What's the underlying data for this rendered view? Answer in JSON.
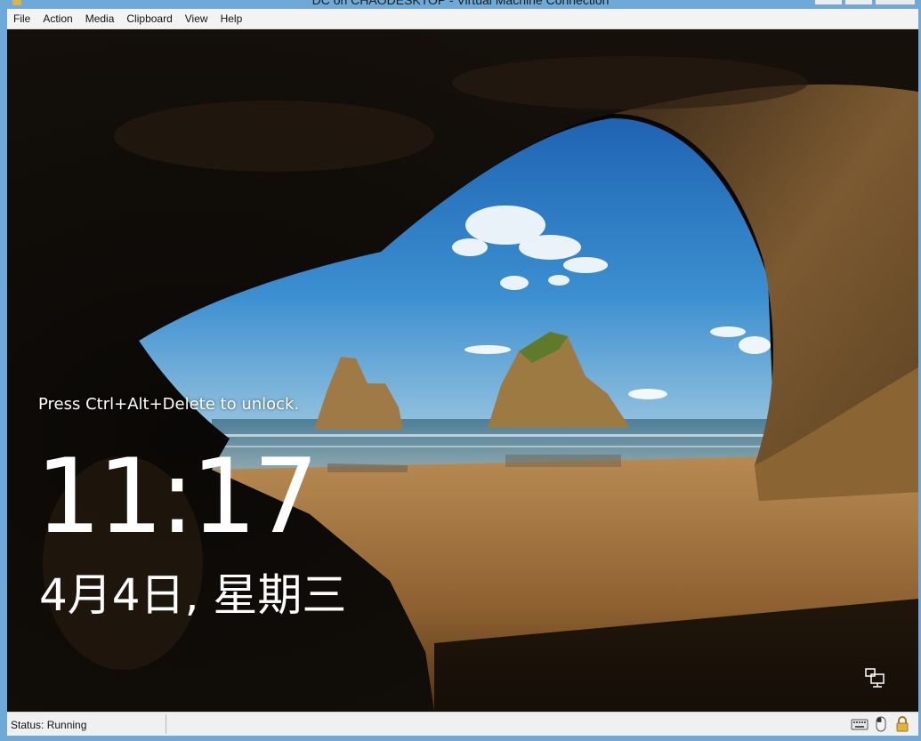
{
  "window": {
    "title": "DC on CHAODESKTOP - Virtual Machine Connection"
  },
  "menu": {
    "items": [
      {
        "label": "File"
      },
      {
        "label": "Action"
      },
      {
        "label": "Media"
      },
      {
        "label": "Clipboard"
      },
      {
        "label": "View"
      },
      {
        "label": "Help"
      }
    ]
  },
  "lockscreen": {
    "unlock_prompt": "Press Ctrl+Alt+Delete to unlock.",
    "time": "11:17",
    "date": "4月4日, 星期三",
    "icons": [
      "network-icon"
    ]
  },
  "status": {
    "text": "Status: Running",
    "icons": [
      "keyboard-icon",
      "mouse-icon",
      "lock-icon"
    ]
  },
  "colors": {
    "frame": "#6fa9d8",
    "menubar": "#f3f3f3",
    "sky": "#2f7fc4",
    "sand": "#a0703a",
    "rock": "#1c140d"
  }
}
